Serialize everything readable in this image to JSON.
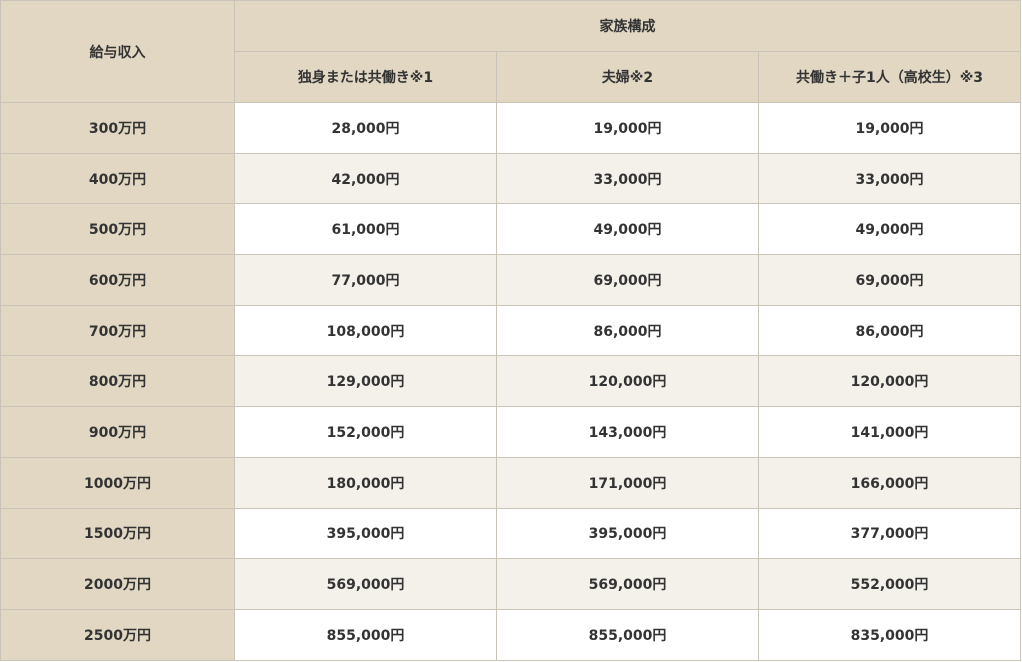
{
  "table": {
    "corner_header": "給与収入",
    "group_header": "家族構成",
    "columns": [
      "独身または共働き※1",
      "夫婦※2",
      "共働き＋子1人（高校生）※3"
    ],
    "rows": [
      {
        "income": "300万円",
        "values": [
          "28,000円",
          "19,000円",
          "19,000円"
        ]
      },
      {
        "income": "400万円",
        "values": [
          "42,000円",
          "33,000円",
          "33,000円"
        ]
      },
      {
        "income": "500万円",
        "values": [
          "61,000円",
          "49,000円",
          "49,000円"
        ]
      },
      {
        "income": "600万円",
        "values": [
          "77,000円",
          "69,000円",
          "69,000円"
        ]
      },
      {
        "income": "700万円",
        "values": [
          "108,000円",
          "86,000円",
          "86,000円"
        ]
      },
      {
        "income": "800万円",
        "values": [
          "129,000円",
          "120,000円",
          "120,000円"
        ]
      },
      {
        "income": "900万円",
        "values": [
          "152,000円",
          "143,000円",
          "141,000円"
        ]
      },
      {
        "income": "1000万円",
        "values": [
          "180,000円",
          "171,000円",
          "166,000円"
        ]
      },
      {
        "income": "1500万円",
        "values": [
          "395,000円",
          "395,000円",
          "377,000円"
        ]
      },
      {
        "income": "2000万円",
        "values": [
          "569,000円",
          "569,000円",
          "552,000円"
        ]
      },
      {
        "income": "2500万円",
        "values": [
          "855,000円",
          "855,000円",
          "835,000円"
        ]
      }
    ]
  }
}
